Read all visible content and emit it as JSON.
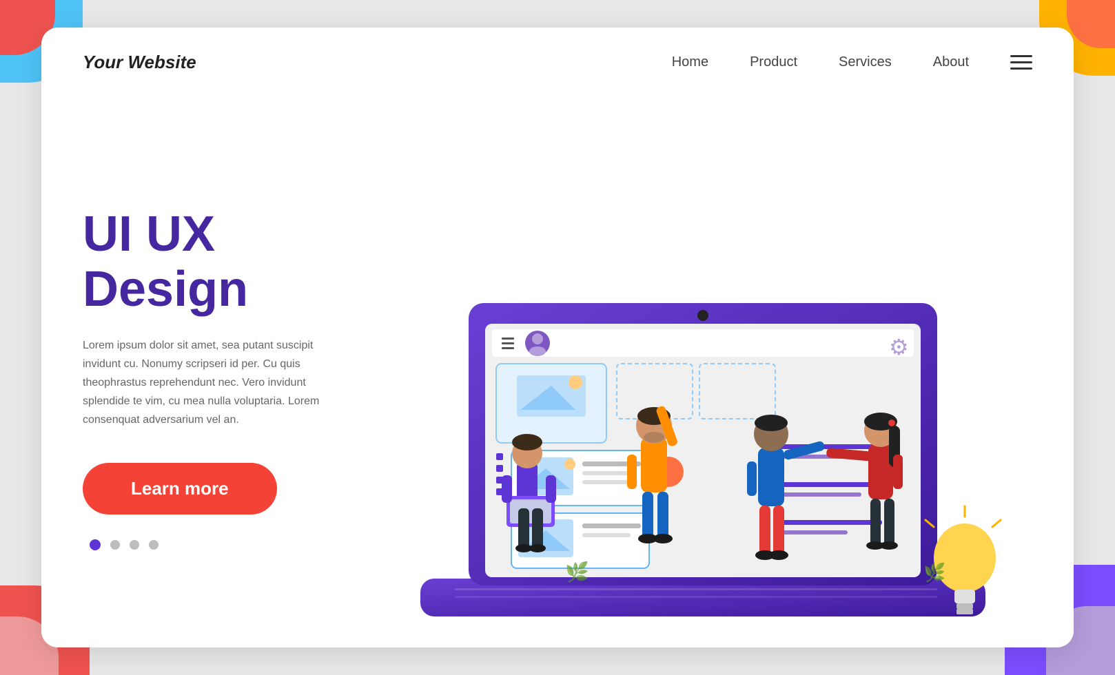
{
  "page": {
    "background_color": "#e8e8e8",
    "card_bg": "#ffffff"
  },
  "navbar": {
    "logo": "Your Website",
    "links": [
      {
        "id": "home",
        "label": "Home"
      },
      {
        "id": "product",
        "label": "Product"
      },
      {
        "id": "services",
        "label": "Services"
      },
      {
        "id": "about",
        "label": "About"
      }
    ],
    "hamburger_lines": 3
  },
  "hero": {
    "title_line1": "UI UX",
    "title_line2": "Design",
    "body_text": "Lorem ipsum dolor sit amet, sea putant suscipit invidunt cu. Nonumy scripseri id per. Cu quis theophrastus reprehendunt nec. Vero invidunt splendide te vim, cu mea nulla voluptaria. Lorem consenquat adversarium vel an.",
    "cta_label": "Learn more",
    "dots": [
      {
        "active": true
      },
      {
        "active": false
      },
      {
        "active": false
      },
      {
        "active": false
      }
    ]
  },
  "illustration": {
    "laptop_color": "#5c35d4",
    "screen_bg": "#ffffff",
    "ui_elements": {
      "image_boxes": 3,
      "line_colors": [
        "#5c35d4",
        "#cccccc"
      ]
    }
  },
  "corners": {
    "top_left_color1": "#4fc3f7",
    "top_left_color2": "#ef5350",
    "top_right_color1": "#ffb300",
    "top_right_color2": "#ff7043",
    "bottom_left_color1": "#ef5350",
    "bottom_right_color1": "#7c4dff"
  }
}
